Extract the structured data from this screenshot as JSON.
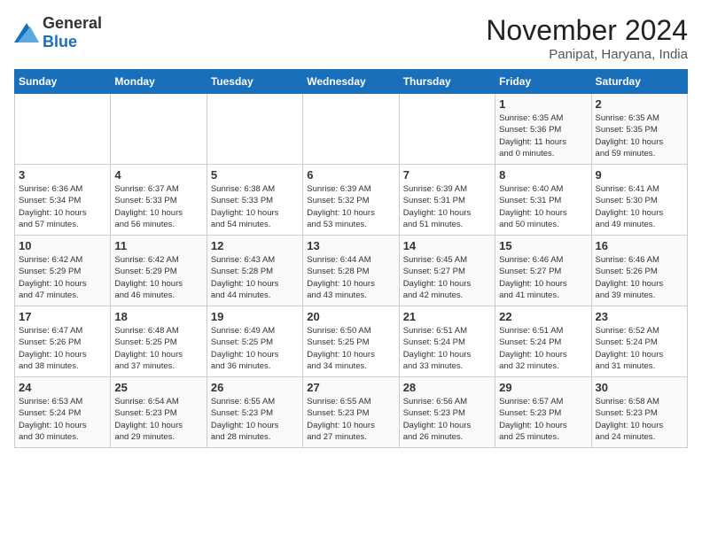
{
  "logo": {
    "general": "General",
    "blue": "Blue"
  },
  "title": "November 2024",
  "location": "Panipat, Haryana, India",
  "days_header": [
    "Sunday",
    "Monday",
    "Tuesday",
    "Wednesday",
    "Thursday",
    "Friday",
    "Saturday"
  ],
  "weeks": [
    [
      {
        "day": "",
        "info": ""
      },
      {
        "day": "",
        "info": ""
      },
      {
        "day": "",
        "info": ""
      },
      {
        "day": "",
        "info": ""
      },
      {
        "day": "",
        "info": ""
      },
      {
        "day": "1",
        "info": "Sunrise: 6:35 AM\nSunset: 5:36 PM\nDaylight: 11 hours\nand 0 minutes."
      },
      {
        "day": "2",
        "info": "Sunrise: 6:35 AM\nSunset: 5:35 PM\nDaylight: 10 hours\nand 59 minutes."
      }
    ],
    [
      {
        "day": "3",
        "info": "Sunrise: 6:36 AM\nSunset: 5:34 PM\nDaylight: 10 hours\nand 57 minutes."
      },
      {
        "day": "4",
        "info": "Sunrise: 6:37 AM\nSunset: 5:33 PM\nDaylight: 10 hours\nand 56 minutes."
      },
      {
        "day": "5",
        "info": "Sunrise: 6:38 AM\nSunset: 5:33 PM\nDaylight: 10 hours\nand 54 minutes."
      },
      {
        "day": "6",
        "info": "Sunrise: 6:39 AM\nSunset: 5:32 PM\nDaylight: 10 hours\nand 53 minutes."
      },
      {
        "day": "7",
        "info": "Sunrise: 6:39 AM\nSunset: 5:31 PM\nDaylight: 10 hours\nand 51 minutes."
      },
      {
        "day": "8",
        "info": "Sunrise: 6:40 AM\nSunset: 5:31 PM\nDaylight: 10 hours\nand 50 minutes."
      },
      {
        "day": "9",
        "info": "Sunrise: 6:41 AM\nSunset: 5:30 PM\nDaylight: 10 hours\nand 49 minutes."
      }
    ],
    [
      {
        "day": "10",
        "info": "Sunrise: 6:42 AM\nSunset: 5:29 PM\nDaylight: 10 hours\nand 47 minutes."
      },
      {
        "day": "11",
        "info": "Sunrise: 6:42 AM\nSunset: 5:29 PM\nDaylight: 10 hours\nand 46 minutes."
      },
      {
        "day": "12",
        "info": "Sunrise: 6:43 AM\nSunset: 5:28 PM\nDaylight: 10 hours\nand 44 minutes."
      },
      {
        "day": "13",
        "info": "Sunrise: 6:44 AM\nSunset: 5:28 PM\nDaylight: 10 hours\nand 43 minutes."
      },
      {
        "day": "14",
        "info": "Sunrise: 6:45 AM\nSunset: 5:27 PM\nDaylight: 10 hours\nand 42 minutes."
      },
      {
        "day": "15",
        "info": "Sunrise: 6:46 AM\nSunset: 5:27 PM\nDaylight: 10 hours\nand 41 minutes."
      },
      {
        "day": "16",
        "info": "Sunrise: 6:46 AM\nSunset: 5:26 PM\nDaylight: 10 hours\nand 39 minutes."
      }
    ],
    [
      {
        "day": "17",
        "info": "Sunrise: 6:47 AM\nSunset: 5:26 PM\nDaylight: 10 hours\nand 38 minutes."
      },
      {
        "day": "18",
        "info": "Sunrise: 6:48 AM\nSunset: 5:25 PM\nDaylight: 10 hours\nand 37 minutes."
      },
      {
        "day": "19",
        "info": "Sunrise: 6:49 AM\nSunset: 5:25 PM\nDaylight: 10 hours\nand 36 minutes."
      },
      {
        "day": "20",
        "info": "Sunrise: 6:50 AM\nSunset: 5:25 PM\nDaylight: 10 hours\nand 34 minutes."
      },
      {
        "day": "21",
        "info": "Sunrise: 6:51 AM\nSunset: 5:24 PM\nDaylight: 10 hours\nand 33 minutes."
      },
      {
        "day": "22",
        "info": "Sunrise: 6:51 AM\nSunset: 5:24 PM\nDaylight: 10 hours\nand 32 minutes."
      },
      {
        "day": "23",
        "info": "Sunrise: 6:52 AM\nSunset: 5:24 PM\nDaylight: 10 hours\nand 31 minutes."
      }
    ],
    [
      {
        "day": "24",
        "info": "Sunrise: 6:53 AM\nSunset: 5:24 PM\nDaylight: 10 hours\nand 30 minutes."
      },
      {
        "day": "25",
        "info": "Sunrise: 6:54 AM\nSunset: 5:23 PM\nDaylight: 10 hours\nand 29 minutes."
      },
      {
        "day": "26",
        "info": "Sunrise: 6:55 AM\nSunset: 5:23 PM\nDaylight: 10 hours\nand 28 minutes."
      },
      {
        "day": "27",
        "info": "Sunrise: 6:55 AM\nSunset: 5:23 PM\nDaylight: 10 hours\nand 27 minutes."
      },
      {
        "day": "28",
        "info": "Sunrise: 6:56 AM\nSunset: 5:23 PM\nDaylight: 10 hours\nand 26 minutes."
      },
      {
        "day": "29",
        "info": "Sunrise: 6:57 AM\nSunset: 5:23 PM\nDaylight: 10 hours\nand 25 minutes."
      },
      {
        "day": "30",
        "info": "Sunrise: 6:58 AM\nSunset: 5:23 PM\nDaylight: 10 hours\nand 24 minutes."
      }
    ]
  ]
}
